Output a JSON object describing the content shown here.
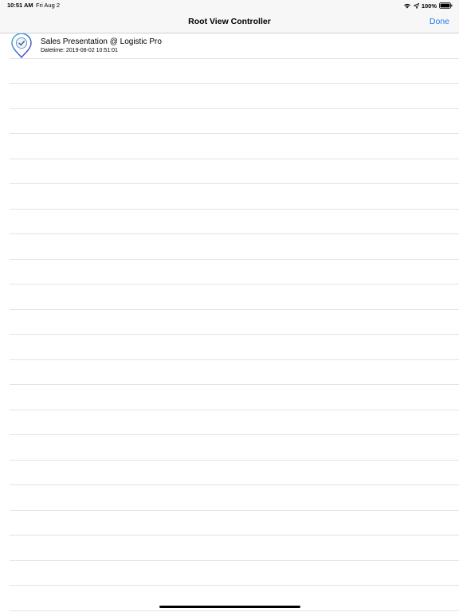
{
  "status_bar": {
    "time": "10:51 AM",
    "date": "Fri Aug 2",
    "battery": "100%",
    "icons": [
      "wifi-icon",
      "location-arrow-icon",
      "battery-icon"
    ]
  },
  "nav": {
    "title": "Root View Controller",
    "done_label": "Done"
  },
  "list": {
    "items": [
      {
        "title": "Sales Presentation @ Logistic Pro",
        "subtitle": "Datetime: 2019-08-02 10:51:01",
        "icon": "location-pin-check-icon"
      }
    ],
    "empty_rows": 22
  },
  "colors": {
    "accent": "#1e7ef0",
    "bar_background": "#f7f7f7",
    "separator": "#e3e3e6"
  }
}
